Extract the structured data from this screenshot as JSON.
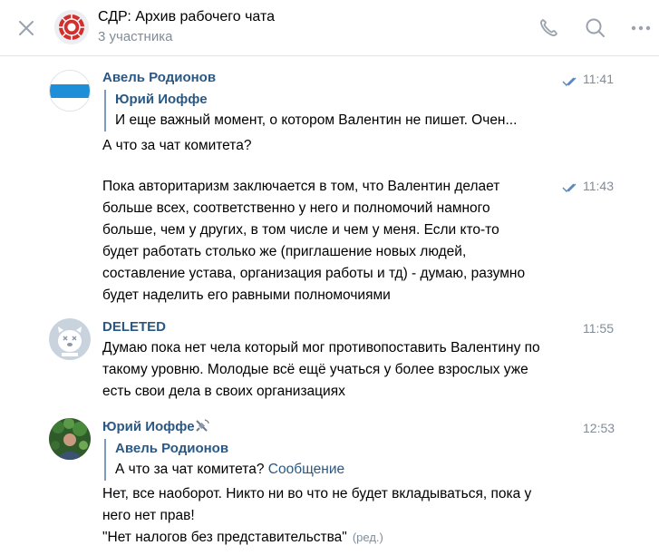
{
  "header": {
    "title": "СДР: Архив рабочего чата",
    "subtitle": "3 участника"
  },
  "colors": {
    "link": "#2a5885",
    "muted": "#818c99",
    "read_check": "#5b88bd",
    "chat_avatar_red": "#d2302e"
  },
  "icons": [
    "close-icon",
    "phone-icon",
    "search-icon",
    "more-icon",
    "read-checkmark-icon",
    "satellite-icon"
  ],
  "messages": [
    {
      "author": "Авель Родионов",
      "time": "11:41",
      "reply": {
        "author": "Юрий Иоффе",
        "text": "И еще важный момент, о котором Валентин не пишет. Очен..."
      },
      "lines": [
        "А что за чат комитета?"
      ]
    },
    {
      "time": "11:43",
      "lines": [
        "Пока авторитаризм заключается в том, что Валентин делает",
        "больше всех, соответственно у него и полномочий намного",
        "больше, чем у других, в том числе и чем у меня. Если кто-то",
        "будет работать столько же (приглашение новых людей,",
        "составление устава, организация работы и тд) - думаю, разумно",
        "будет наделить его равными полномочиями"
      ]
    },
    {
      "author": "DELETED",
      "time": "11:55",
      "lines": [
        "Думаю пока нет чела который мог противопоставить Валентину по",
        "такому уровню. Молодые всё ещё учаться у более взрослых уже",
        "есть свои дела в своих организациях"
      ]
    },
    {
      "author": "Юрий Иоффе",
      "time": "12:53",
      "reply": {
        "author": "Авель Родионов",
        "text": "А что за чат комитета?",
        "link": "Сообщение"
      },
      "lines": [
        "Нет, все наоборот. Никто ни во что не будет вкладываться, пока у",
        "него нет прав!",
        "\"Нет налогов без представительства\""
      ],
      "edited": "(ред.)"
    }
  ]
}
